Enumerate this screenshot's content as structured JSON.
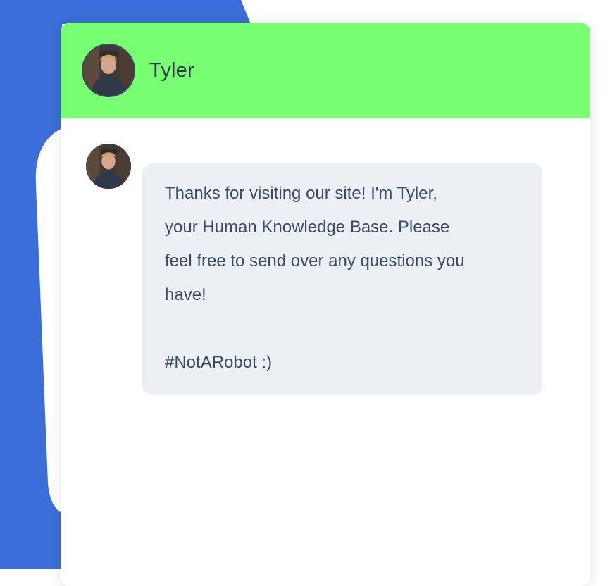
{
  "colors": {
    "background_blue": "#3b6ed8",
    "header_green": "#78ff72",
    "bubble_background": "#ebf0f4",
    "message_text": "#3c4a63"
  },
  "header": {
    "agent_name": "Tyler",
    "avatar_icon": "profile-photo"
  },
  "message": {
    "avatar_icon": "profile-photo",
    "lines": [
      "Thanks for visiting our site! I'm Tyler,",
      "your Human Knowledge Base. Please",
      "feel free to send over any questions you",
      "have!"
    ],
    "hashtag": "#NotARobot :)"
  }
}
